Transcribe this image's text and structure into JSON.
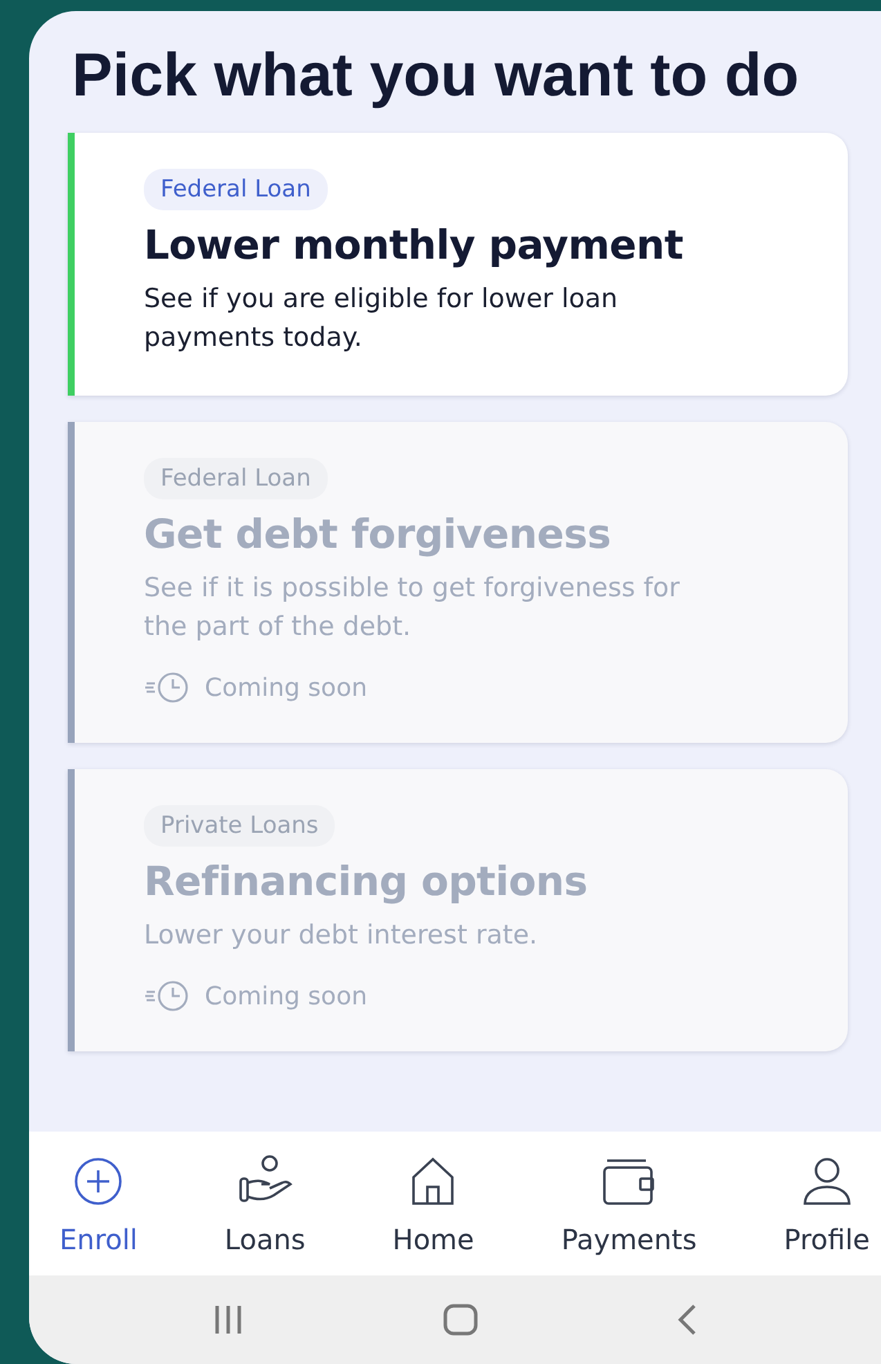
{
  "title": "Pick what you want to do",
  "options": [
    {
      "tag": "Federal Loan",
      "heading": "Lower monthly payment",
      "description": "See if you are eligible for lower loan payments today.",
      "disabled": false
    },
    {
      "tag": "Federal Loan",
      "heading": "Get debt forgiveness",
      "description": "See if it is possible to get forgiveness for the part of the debt.",
      "disabled": true,
      "status": "Coming soon"
    },
    {
      "tag": "Private Loans",
      "heading": "Refinancing options",
      "description": "Lower your debt interest rate.",
      "disabled": true,
      "status": "Coming soon"
    }
  ],
  "nav": [
    {
      "label": "Enroll",
      "selected": true
    },
    {
      "label": "Loans",
      "selected": false
    },
    {
      "label": "Home",
      "selected": false
    },
    {
      "label": "Payments",
      "selected": false
    },
    {
      "label": "Profile",
      "selected": false
    }
  ]
}
